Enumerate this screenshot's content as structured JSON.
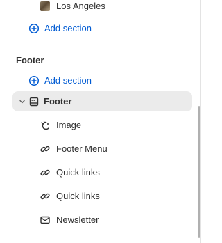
{
  "top_item": {
    "label": "Los Angeles",
    "icon": "image-thumbnail"
  },
  "header_group": {
    "add_section_label": "Add section"
  },
  "footer_group": {
    "heading": "Footer",
    "add_section_label": "Add section",
    "section": {
      "label": "Footer",
      "icon": "footer-layout-icon",
      "expanded": true,
      "blocks": [
        {
          "label": "Image",
          "icon": "image-icon"
        },
        {
          "label": "Footer Menu",
          "icon": "link-icon"
        },
        {
          "label": "Quick links",
          "icon": "link-icon"
        },
        {
          "label": "Quick links",
          "icon": "link-icon"
        },
        {
          "label": "Newsletter",
          "icon": "envelope-icon"
        }
      ]
    }
  },
  "colors": {
    "accent": "#005bd3",
    "text": "#303030",
    "selected_bg": "#ebebeb",
    "divider": "#e3e3e3"
  }
}
